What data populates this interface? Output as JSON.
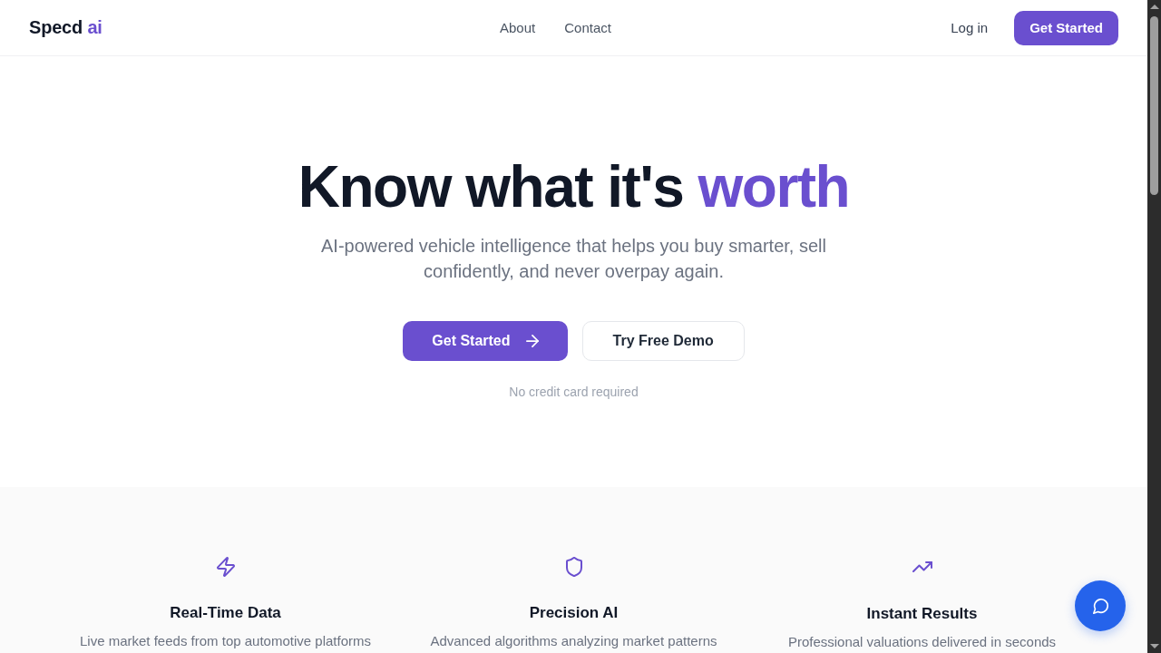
{
  "header": {
    "logo": {
      "name": "Specd",
      "accent": "ai"
    },
    "nav_links": [
      "About",
      "Contact"
    ],
    "login_link": "Log in",
    "cta_button": "Get Started"
  },
  "hero": {
    "headline": "Know what it's",
    "headline_accent": "worth",
    "subtitle": "AI-powered vehicle intelligence that helps you buy smarter, sell confidently, and never overpay again.",
    "primary_button": "Get Started",
    "secondary_button": "Try Free Demo",
    "note": "No credit card required"
  },
  "features": [
    {
      "kind": "bolt",
      "title": "Real-Time Data",
      "description": "Live market feeds from top automotive platforms"
    },
    {
      "kind": "shield",
      "title": "Precision AI",
      "description": "Advanced algorithms analyzing market patterns"
    },
    {
      "kind": "trend",
      "title": "Instant Results",
      "description": "Professional valuations delivered in seconds"
    }
  ]
}
